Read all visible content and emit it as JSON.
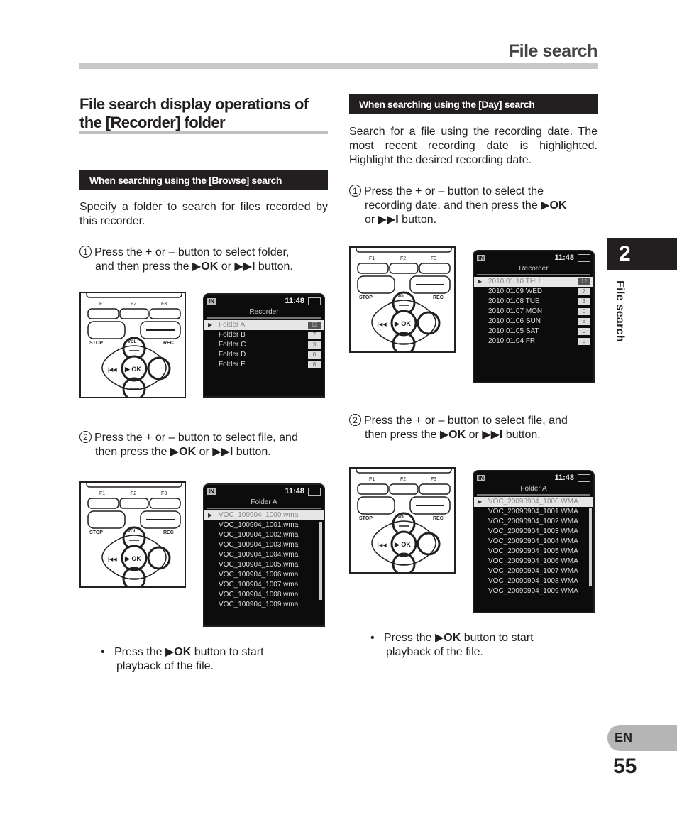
{
  "header": {
    "title": "File search"
  },
  "section": {
    "title": "File search display operations of the [Recorder] folder"
  },
  "left": {
    "subhead": "When searching using the [Browse] search",
    "intro": "Specify a folder to search for files recorded by this recorder.",
    "step1": {
      "num": "1",
      "line1": "Press the + or – button to select folder,",
      "line2_pre": "and then press the ",
      "ok": "▶OK",
      "or": " or ",
      "ff": "▶▶I",
      "line2_post": " button."
    },
    "step2": {
      "num": "2",
      "line1": "Press the + or – button to select file, and",
      "line2_pre": "then press the ",
      "ok": "▶OK",
      "or": " or ",
      "ff": "▶▶I",
      "line2_post": " button."
    },
    "screen1": {
      "in": "IN",
      "time": "11:48",
      "title": "Recorder",
      "rows": [
        {
          "label": "Folder A",
          "count": "12"
        },
        {
          "label": "Folder B",
          "count": "7"
        },
        {
          "label": "Folder C",
          "count": "3"
        },
        {
          "label": "Folder D",
          "count": "0"
        },
        {
          "label": "Folder E",
          "count": "8"
        }
      ]
    },
    "screen2": {
      "in": "IN",
      "time": "11:48",
      "title": "Folder A",
      "rows": [
        "VOC_100904_1000.wma",
        "VOC_100904_1001.wma",
        "VOC_100904_1002.wma",
        "VOC_100904_1003.wma",
        "VOC_100904_1004.wma",
        "VOC_100904_1005.wma",
        "VOC_100904_1006.wma",
        "VOC_100904_1007.wma",
        "VOC_100904_1008.wma",
        "VOC_100904_1009.wma"
      ]
    },
    "bullet": {
      "pre": "Press the ",
      "ok": "▶OK",
      "post": " button to start",
      "line2": "playback of the file."
    }
  },
  "right": {
    "subhead": "When searching using the [Day] search",
    "intro": "Search for a file using the recording date. The most recent recording date is highlighted. Highlight the desired recording date.",
    "step1": {
      "num": "1",
      "line1": "Press the + or – button to select the",
      "line2": "recording date, and then press the ",
      "ok": "▶OK",
      "line3_pre": "or ",
      "ff": "▶▶I",
      "line3_post": " button."
    },
    "step2": {
      "num": "2",
      "line1": "Press the + or – button to select file, and",
      "line2_pre": "then press the ",
      "ok": "▶OK",
      "or": " or ",
      "ff": "▶▶I",
      "line2_post": " button."
    },
    "screen1": {
      "in": "IN",
      "time": "11:48",
      "title": "Recorder",
      "rows": [
        {
          "label": "2010.01.10 THU",
          "count": "12"
        },
        {
          "label": "2010.01.09 WED",
          "count": "7"
        },
        {
          "label": "2010.01.08 TUE",
          "count": "3"
        },
        {
          "label": "2010.01.07 MON",
          "count": "0"
        },
        {
          "label": "2010.01.06 SUN",
          "count": "8"
        },
        {
          "label": "2010.01.05 SAT",
          "count": "0"
        },
        {
          "label": "2010.01.04 FRI",
          "count": "0"
        }
      ]
    },
    "screen2": {
      "in": "IN",
      "time": "11:48",
      "title": "Folder A",
      "rows": [
        "VOC_20090904_1000 WMA",
        "VOC_20090904_1001 WMA",
        "VOC_20090904_1002 WMA",
        "VOC_20090904_1003 WMA",
        "VOC_20090904_1004 WMA",
        "VOC_20090904_1005 WMA",
        "VOC_20090904_1006 WMA",
        "VOC_20090904_1007 WMA",
        "VOC_20090904_1008 WMA",
        "VOC_20090904_1009 WMA"
      ]
    },
    "bullet": {
      "pre": "Press the ",
      "ok": "▶OK",
      "post": " button to start",
      "line2": "playback of the file."
    }
  },
  "device": {
    "f1": "F1",
    "f2": "F2",
    "f3": "F3",
    "stop": "STOP",
    "rec": "REC",
    "vol": "VOL",
    "ok": "▶ OK"
  },
  "sidebar": {
    "chapter": "2",
    "label": "File search",
    "lang": "EN",
    "page": "55"
  }
}
